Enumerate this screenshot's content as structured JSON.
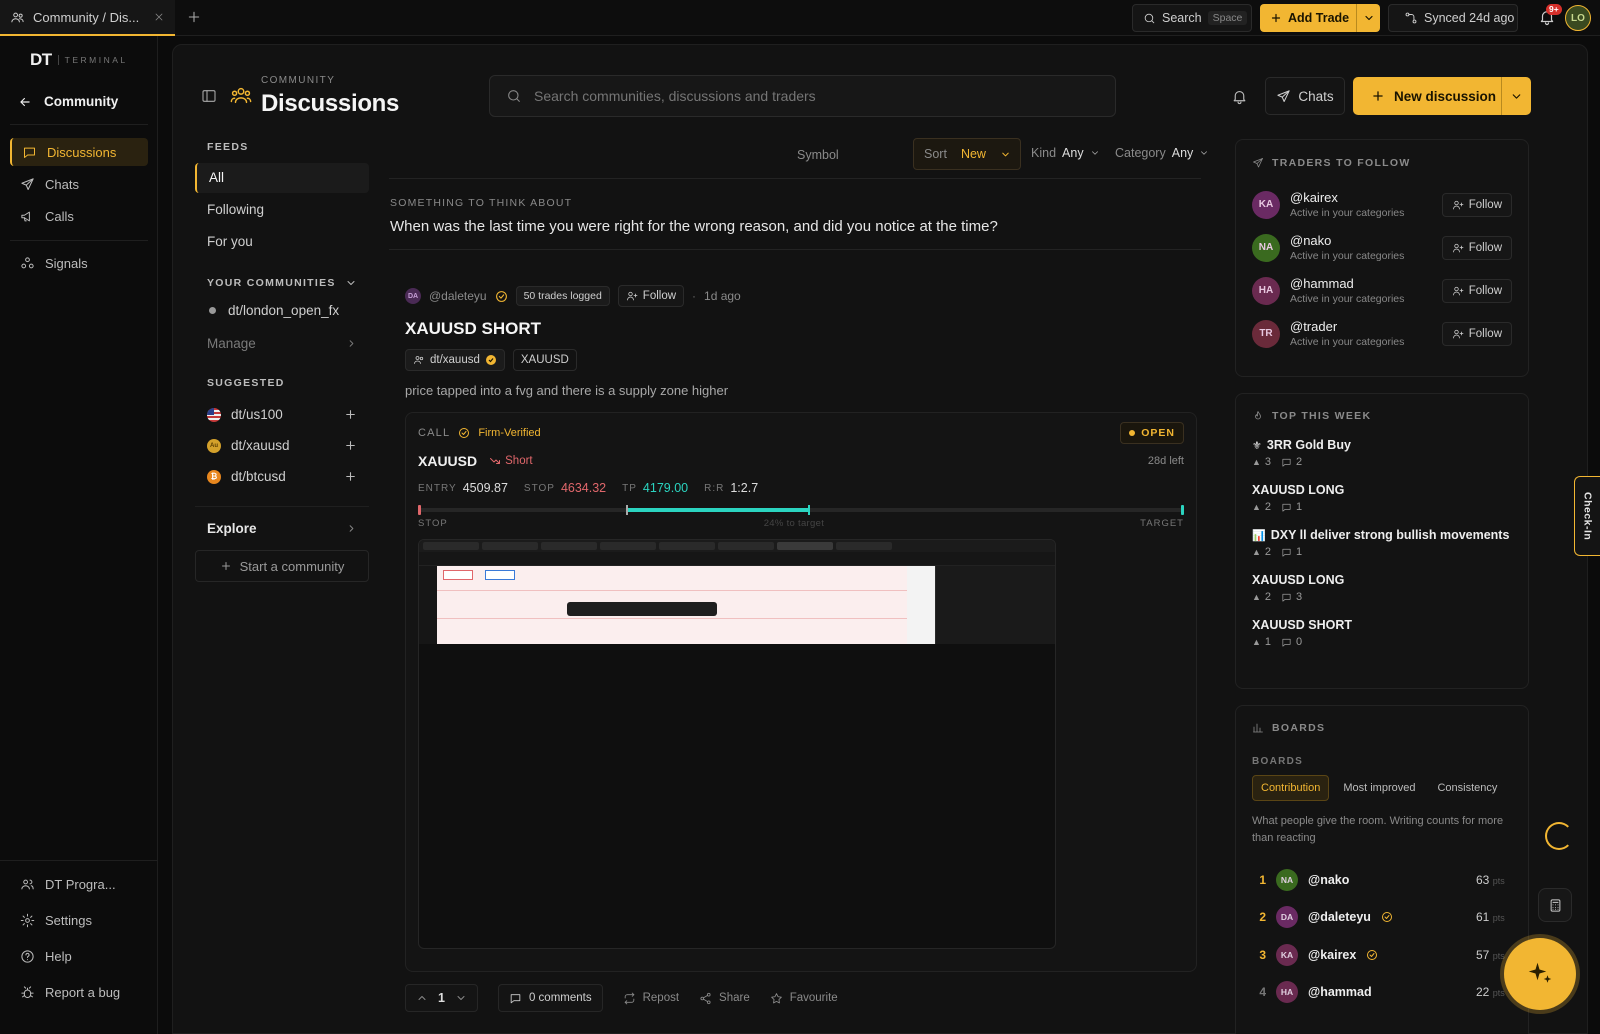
{
  "topbar": {
    "tab_title": "Community / Dis...",
    "search_label": "Search",
    "search_shortcut": "Space",
    "add_trade_label": "Add Trade",
    "synced_label": "Synced 24d ago",
    "notif_count": "9+",
    "user_initials": "LO"
  },
  "sidebar": {
    "brand": "DT",
    "brand_sub": "TERMINAL",
    "back_label": "Community",
    "items": [
      {
        "label": "Discussions"
      },
      {
        "label": "Chats"
      },
      {
        "label": "Calls"
      },
      {
        "label": "Signals"
      }
    ],
    "bottom": [
      {
        "label": "DT Progra..."
      },
      {
        "label": "Settings"
      },
      {
        "label": "Help"
      },
      {
        "label": "Report a bug"
      }
    ]
  },
  "header": {
    "eyebrow": "COMMUNITY",
    "title": "Discussions",
    "search_placeholder": "Search communities, discussions and traders",
    "chats_label": "Chats",
    "new_discussion_label": "New discussion"
  },
  "feeds": {
    "heading": "FEEDS",
    "items": [
      "All",
      "Following",
      "For you"
    ],
    "communities_heading": "YOUR COMMUNITIES",
    "communities": [
      "dt/london_open_fx"
    ],
    "manage_label": "Manage",
    "suggested_heading": "SUGGESTED",
    "suggested": [
      "dt/us100",
      "dt/xauusd",
      "dt/btcusd"
    ],
    "explore_label": "Explore",
    "start_label": "Start a community"
  },
  "filters": {
    "symbol_label": "Symbol",
    "sort_label": "Sort",
    "sort_value": "New",
    "kind_label": "Kind",
    "kind_value": "Any",
    "category_label": "Category",
    "category_value": "Any"
  },
  "prompt": {
    "eyebrow": "SOMETHING TO THINK ABOUT",
    "question": "When was the last time you were right for the wrong reason, and did you notice at the time?"
  },
  "post": {
    "avatar_initials": "DA",
    "author": "@daleteyu",
    "trades_badge": "50 trades logged",
    "follow_label": "Follow",
    "time": "1d ago",
    "title": "XAUUSD SHORT",
    "community_tag": "dt/xauusd",
    "symbol_tag": "XAUUSD",
    "body": "price tapped into a fvg and there is a supply zone higher",
    "call": {
      "label": "CALL",
      "verified_label": "Firm-Verified",
      "status": "OPEN",
      "symbol": "XAUUSD",
      "direction": "Short",
      "time_left": "28d left",
      "entry_label": "ENTRY",
      "entry": "4509.87",
      "stop_label": "STOP",
      "stop": "4634.32",
      "tp_label": "TP",
      "tp": "4179.00",
      "rr_label": "R:R",
      "rr": "1:2.7",
      "progress_text": "24% to target",
      "progress": 0.24,
      "bar_stop_label": "STOP",
      "bar_target_label": "TARGET"
    },
    "actions": {
      "votes": "1",
      "comments": "0 comments",
      "repost": "Repost",
      "share": "Share",
      "favourite": "Favourite"
    }
  },
  "traders": {
    "heading": "TRADERS TO FOLLOW",
    "follow_label": "Follow",
    "items": [
      {
        "initials": "KA",
        "handle": "@kairex",
        "sub": "Active in your categories",
        "color": "#6a2a63"
      },
      {
        "initials": "NA",
        "handle": "@nako",
        "sub": "Active in your categories",
        "color": "#3a6a1f"
      },
      {
        "initials": "HA",
        "handle": "@hammad",
        "sub": "Active in your categories",
        "color": "#6a2a50"
      },
      {
        "initials": "TR",
        "handle": "@trader",
        "sub": "Active in your categories",
        "color": "#6a2a3a"
      }
    ]
  },
  "top_week": {
    "heading": "TOP THIS WEEK",
    "items": [
      {
        "icon": "⚜",
        "title": "3RR Gold Buy",
        "votes": "3",
        "comments": "2"
      },
      {
        "icon": "",
        "title": "XAUUSD LONG",
        "votes": "2",
        "comments": "1"
      },
      {
        "icon": "📊",
        "title": "DXY ll deliver strong bullish movements",
        "votes": "2",
        "comments": "1"
      },
      {
        "icon": "",
        "title": "XAUUSD LONG",
        "votes": "2",
        "comments": "3"
      },
      {
        "icon": "",
        "title": "XAUUSD SHORT",
        "votes": "1",
        "comments": "0"
      }
    ]
  },
  "boards": {
    "heading": "BOARDS",
    "sub_heading": "BOARDS",
    "tabs": [
      "Contribution",
      "Most improved",
      "Consistency"
    ],
    "desc": "What people give the room. Writing counts for more than reacting",
    "pts_unit": "pts",
    "rows": [
      {
        "rank": "1",
        "initials": "NA",
        "handle": "@nako",
        "pts": "63",
        "color": "#3a6a1f",
        "verified": false
      },
      {
        "rank": "2",
        "initials": "DA",
        "handle": "@daleteyu",
        "pts": "61",
        "color": "#6a2a63",
        "verified": true
      },
      {
        "rank": "3",
        "initials": "KA",
        "handle": "@kairex",
        "pts": "57",
        "color": "#6a2a50",
        "verified": true
      },
      {
        "rank": "4",
        "initials": "HA",
        "handle": "@hammad",
        "pts": "22",
        "color": "#6a2a50",
        "verified": false
      }
    ]
  },
  "checkin_label": "Check-In",
  "colors": {
    "accent": "#f2b632",
    "stop": "#e0676b",
    "target": "#2bd4c0"
  }
}
